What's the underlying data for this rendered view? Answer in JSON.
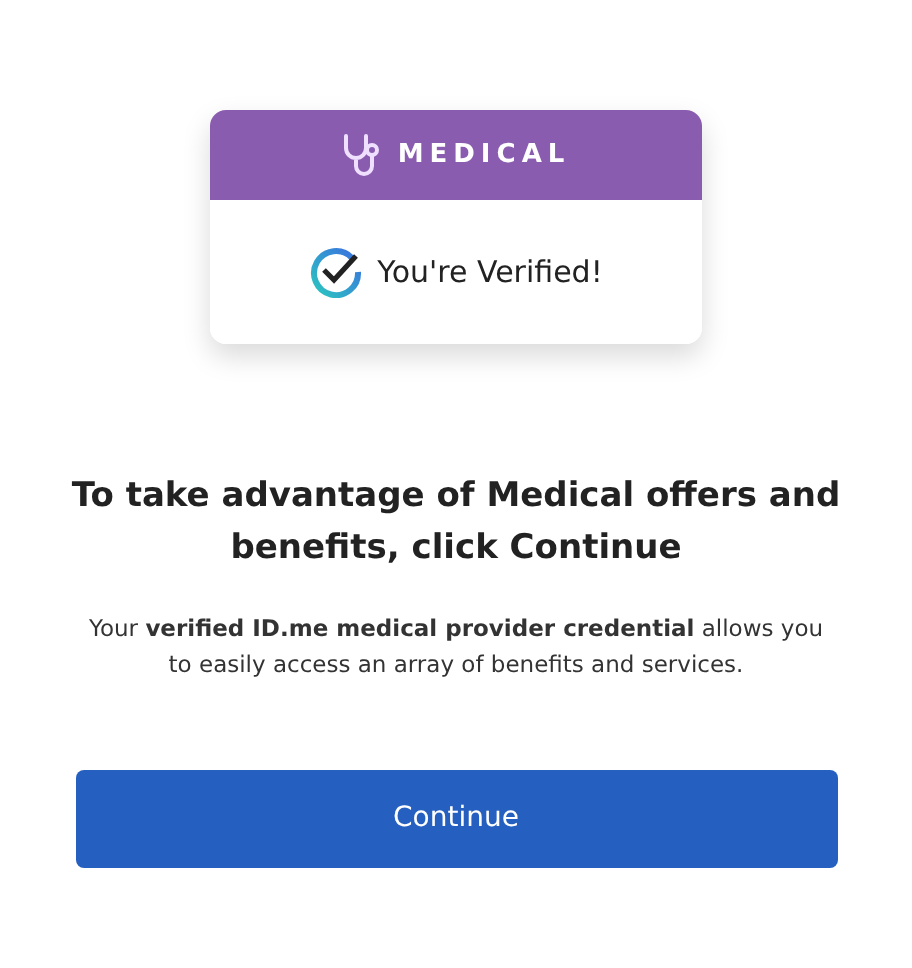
{
  "badge": {
    "category": "MEDICAL",
    "status": "You're Verified!"
  },
  "heading": "To take advantage of Medical offers and benefits, click Continue",
  "description": "Your **verified ID.me medical provider credential** allows you to easily access an array of benefits and services.",
  "button": "Continue"
}
